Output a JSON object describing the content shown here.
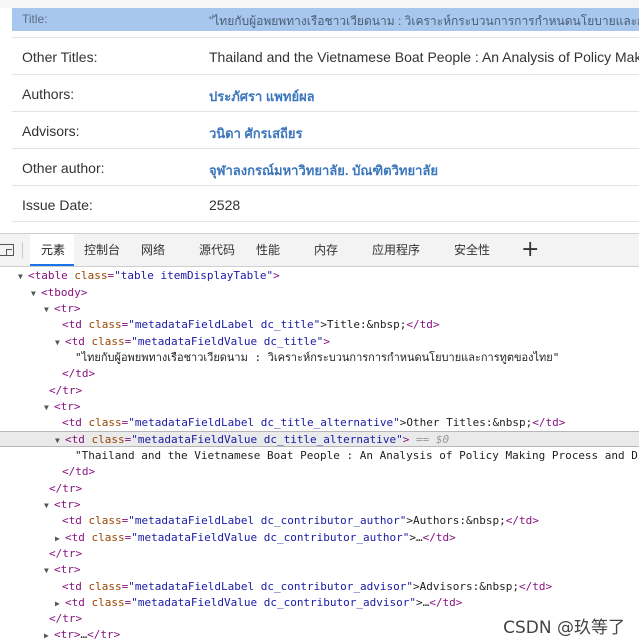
{
  "metadata": {
    "rows": [
      {
        "label": "Title:",
        "value": "\"ไทยกับผู้อพยพทางเรือชาวเวียดนาม : วิเคราะห์กระบวนการการกำหนดนโยบายและการทูตของไทย\""
      },
      {
        "label": "Other Titles:",
        "value": "Thailand and the Vietnamese Boat People : An Analysis of Policy Making Process and Diplomacy"
      },
      {
        "label": "Authors:",
        "value": "ประภัศรา แพทย์ผล"
      },
      {
        "label": "Advisors:",
        "value": "วนิดา ศักรเสถียร"
      },
      {
        "label": "Other author:",
        "value": "จุฬาลงกรณ์มหาวิทยาลัย. บัณฑิตวิทยาลัย"
      },
      {
        "label": "Issue Date:",
        "value": "2528"
      }
    ]
  },
  "devtools": {
    "tabs": [
      "元素",
      "控制台",
      "网络",
      "源代码",
      "性能",
      "内存",
      "应用程序",
      "安全性"
    ],
    "active_tab": "元素",
    "add_tab_label": "+",
    "tree": {
      "l0": {
        "tag": "<table",
        "attr": "class",
        "val": "\"table itemDisplayTable\"",
        "close": ">"
      },
      "l1": {
        "tag": "<tbody>"
      },
      "l2": {
        "tag": "<tr>"
      },
      "l3": {
        "open": "<td",
        "attr": "class",
        "val": "\"metadataFieldLabel dc_title\"",
        "text": ">Title:&nbsp;",
        "close": "</td>"
      },
      "l4": {
        "open": "<td",
        "attr": "class",
        "val": "\"metadataFieldValue dc_title\"",
        "close": ">"
      },
      "l5": {
        "text": "\"ไทยกับผู้อพยพทางเรือชาวเวียดนาม : วิเคราะห์กระบวนการการกำหนดนโยบายและการทูตของไทย\""
      },
      "l6": {
        "tag": "</td>"
      },
      "l7": {
        "tag": "</tr>"
      },
      "l8": {
        "tag": "<tr>"
      },
      "l9": {
        "open": "<td",
        "attr": "class",
        "val": "\"metadataFieldLabel dc_title_alternative\"",
        "text": ">Other Titles:&nbsp;",
        "close": "</td>"
      },
      "l10": {
        "open": "<td",
        "attr": "class",
        "val": "\"metadataFieldValue dc_title_alternative\"",
        "close": ">",
        "dim": " == $0"
      },
      "l11": {
        "text": "\"Thailand and the Vietnamese Boat People : An Analysis of Policy Making Process and Diplomacy\""
      },
      "l12": {
        "tag": "</td>"
      },
      "l13": {
        "tag": "</tr>"
      },
      "l14": {
        "tag": "<tr>"
      },
      "l15": {
        "open": "<td",
        "attr": "class",
        "val": "\"metadataFieldLabel dc_contributor_author\"",
        "text": ">Authors:&nbsp;",
        "close": "</td>"
      },
      "l16": {
        "open": "<td",
        "attr": "class",
        "val": "\"metadataFieldValue dc_contributor_author\"",
        "text": ">…",
        "close": "</td>"
      },
      "l17": {
        "tag": "</tr>"
      },
      "l18": {
        "tag": "<tr>"
      },
      "l19": {
        "open": "<td",
        "attr": "class",
        "val": "\"metadataFieldLabel dc_contributor_advisor\"",
        "text": ">Advisors:&nbsp;",
        "close": "</td>"
      },
      "l20": {
        "open": "<td",
        "attr": "class",
        "val": "\"metadataFieldValue dc_contributor_advisor\"",
        "text": ">…",
        "close": "</td>"
      },
      "l21": {
        "tag": "</tr>"
      },
      "l22": {
        "open": "<tr>",
        "text": "…",
        "close": "</tr>"
      }
    }
  },
  "watermark": "CSDN @玖等了",
  "colors": {
    "selected_row": "#a7c7ee",
    "link": "#3b76bd",
    "tag": "#881280",
    "attr_name": "#994500",
    "attr_value": "#1a1aa6",
    "active_tab_underline": "#1a73e8"
  }
}
